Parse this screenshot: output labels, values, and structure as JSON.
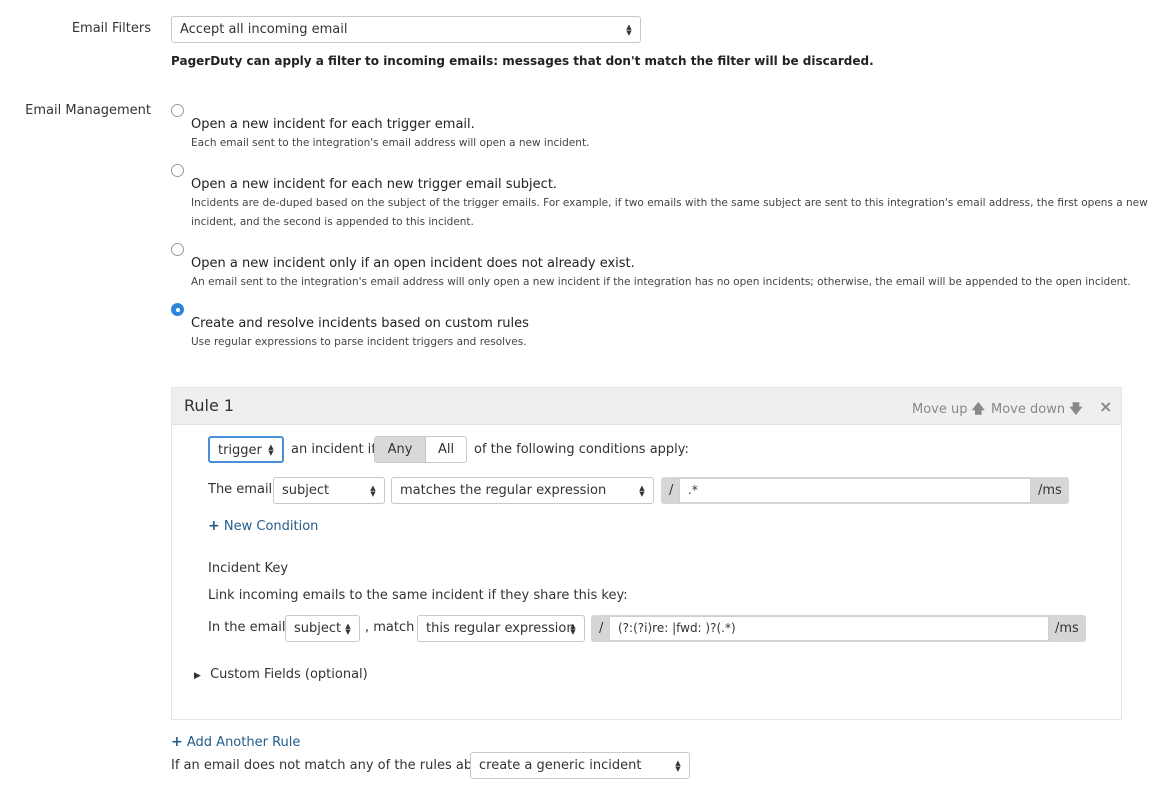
{
  "email_filters": {
    "label": "Email Filters",
    "select_value": "Accept all incoming email",
    "note": "PagerDuty can apply a filter to incoming emails: messages that don't match the filter will be discarded."
  },
  "email_management": {
    "label": "Email Management",
    "options": [
      {
        "title": "Open a new incident for each trigger email.",
        "desc": "Each email sent to the integration's email address will open a new incident.",
        "checked": false
      },
      {
        "title": "Open a new incident for each new trigger email subject.",
        "desc": "Incidents are de-duped based on the subject of the trigger emails. For example, if two emails with the same subject are sent to this integration's email address, the first opens a new",
        "desc2": "incident, and the second is appended to this incident.",
        "checked": false
      },
      {
        "title": "Open a new incident only if an open incident does not already exist.",
        "desc": "An email sent to the integration's email address will only open a new incident if the integration has no open incidents; otherwise, the email will be appended to the open incident.",
        "checked": false
      },
      {
        "title": "Create and resolve incidents based on custom rules",
        "desc": "Use regular expressions to parse incident triggers and resolves.",
        "checked": true
      }
    ]
  },
  "rule": {
    "title": "Rule 1",
    "move_up": "Move up",
    "move_down": "Move down",
    "close": "×",
    "action_select": "trigger",
    "an_incident_if": "an incident if",
    "any_label": "Any",
    "all_label": "All",
    "conditions_apply": "of the following conditions apply:",
    "the_email": "The email",
    "field_select": "subject",
    "match_select": "matches the regular expression",
    "slash": "/",
    "regex_value": ".*",
    "regex_suffix": "/ms",
    "new_condition": "New Condition",
    "incident_key_label": "Incident Key",
    "incident_key_desc": "Link incoming emails to the same incident if they share this key:",
    "in_the_email": "In the email",
    "key_field_select": "subject",
    "comma_match": ", match",
    "key_match_select": "this regular expression",
    "key_regex_value": "(?:(?i)re: |fwd: )?(.*)",
    "key_regex_suffix": "/ms",
    "custom_fields": "Custom Fields (optional)"
  },
  "add_another_rule": "Add Another Rule",
  "fallback_text": "If an email does not match any of the rules above,",
  "fallback_select": "create a generic incident",
  "colors": {
    "accent": "#2b87d8",
    "link": "#245c8a"
  }
}
